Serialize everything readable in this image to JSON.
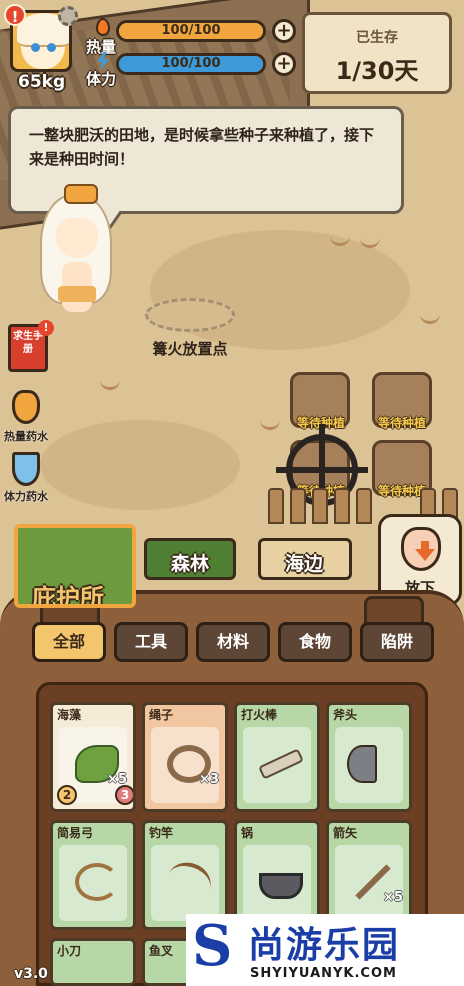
{
  "player": {
    "weight": "65kg",
    "alert": "!",
    "heat_label": "热量",
    "heat_value": "100/100",
    "heat_fraction": 1.0,
    "stamina_label": "体力",
    "stamina_value": "100/100",
    "stamina_fraction": 1.0
  },
  "survival": {
    "title": "已生存",
    "days": "1/30天"
  },
  "dialog": {
    "text": "一整块肥沃的田地，是时候拿些种子来种植了，接下来是种田时间！"
  },
  "scene": {
    "campfire_label": "篝火放置点",
    "plots": [
      "等待种植",
      "等待种植",
      "等待种植",
      "等待种植"
    ]
  },
  "side": {
    "manual_label": "求生手册",
    "manual_badge": "!",
    "heat_potion": "热量药水",
    "stamina_potion": "体力药水"
  },
  "place_button": {
    "label": "放下"
  },
  "locations": {
    "shelter": "庇护所",
    "forest": "森林",
    "beach": "海边"
  },
  "categories": [
    "全部",
    "工具",
    "材料",
    "食物",
    "陷阱"
  ],
  "items": [
    {
      "name": "海藻",
      "qty": "×5",
      "icon": "seaweed-icon",
      "badge_left": "2",
      "badge_right": "3"
    },
    {
      "name": "绳子",
      "qty": "×3",
      "icon": "rope-icon"
    },
    {
      "name": "打火棒",
      "qty": "",
      "icon": "fire-drill-icon"
    },
    {
      "name": "斧头",
      "qty": "",
      "icon": "axe-icon"
    },
    {
      "name": "简易弓",
      "qty": "",
      "icon": "bow-icon"
    },
    {
      "name": "钓竿",
      "qty": "",
      "icon": "fishing-rod-icon"
    },
    {
      "name": "锅",
      "qty": "",
      "icon": "pot-icon"
    },
    {
      "name": "箭矢",
      "qty": "×5",
      "icon": "arrow-icon"
    },
    {
      "name": "小刀",
      "qty": "",
      "icon": "knife-icon"
    },
    {
      "name": "鱼叉",
      "qty": "",
      "icon": "harpoon-icon"
    }
  ],
  "version": "v3.0",
  "watermark": {
    "logo": "S",
    "title": "尚游乐园",
    "subtitle": "SHYIYUANYK.COM"
  },
  "colors": {
    "heat": "#f0a53e",
    "stamina": "#3d9ad8",
    "active_tab": "#f3c56d",
    "tool_card": "#b7d7a6"
  }
}
